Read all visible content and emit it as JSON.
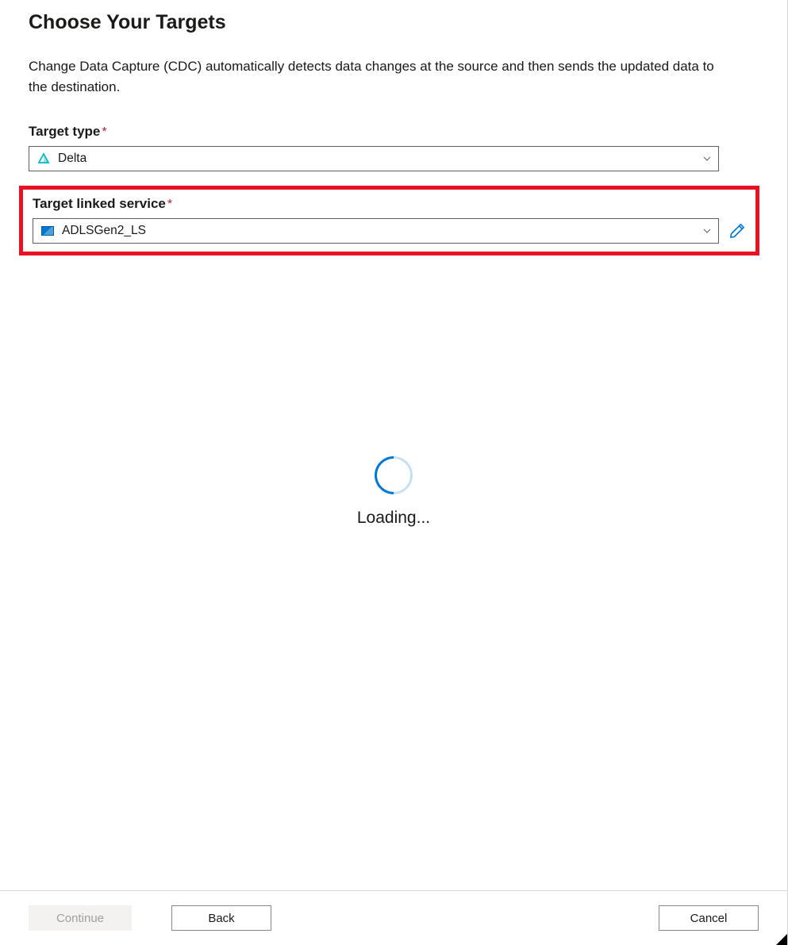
{
  "header": {
    "title": "Choose Your Targets",
    "description": "Change Data Capture (CDC) automatically detects data changes at the source and then sends the updated data to the destination."
  },
  "fields": {
    "target_type": {
      "label": "Target type",
      "required_mark": "*",
      "value": "Delta"
    },
    "target_linked_service": {
      "label": "Target linked service",
      "required_mark": "*",
      "value": "ADLSGen2_LS"
    }
  },
  "loading": {
    "text": "Loading..."
  },
  "footer": {
    "continue": "Continue",
    "back": "Back",
    "cancel": "Cancel"
  }
}
